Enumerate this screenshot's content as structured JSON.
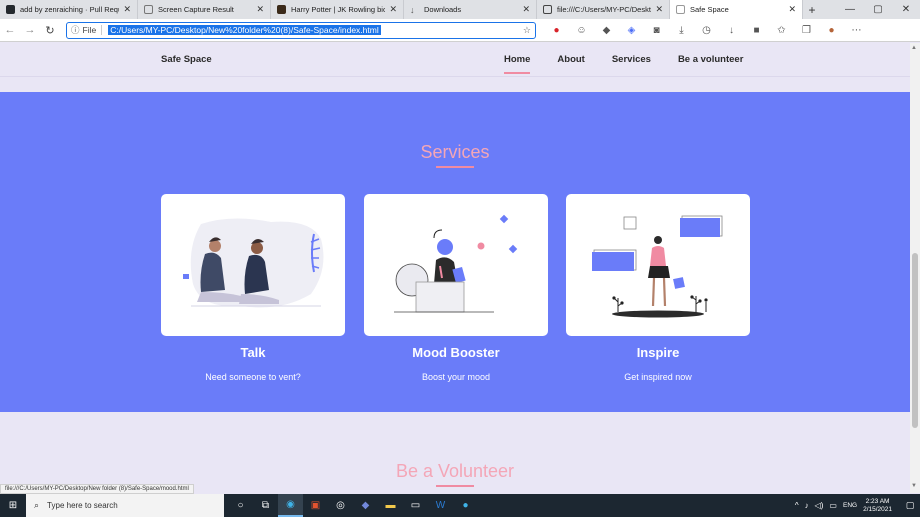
{
  "browser": {
    "tabs": [
      {
        "label": "add by zenraiching · Pull Reque",
        "icon_color": "#24292e",
        "active": false
      },
      {
        "label": "Screen Capture Result",
        "icon_color": "#777777",
        "active": false
      },
      {
        "label": "Harry Potter | JK Rowling biogr",
        "icon_color": "#3b2a1a",
        "active": false
      },
      {
        "label": "Downloads",
        "icon_color": "#555555",
        "active": false
      },
      {
        "label": "file:///C:/Users/MY-PC/Desktop",
        "icon_color": "#444444",
        "active": false
      },
      {
        "label": "Safe Space",
        "icon_color": "#999999",
        "active": true
      }
    ],
    "new_tab": "+",
    "win_controls": {
      "minimize": "—",
      "maximize": "▢",
      "close": "✕"
    },
    "address": {
      "info_icon": "ⓘ",
      "scheme": "File",
      "url": "C:/Users/MY-PC/Desktop/New%20folder%20(8)/Safe-Space/index.html"
    }
  },
  "site": {
    "brand": "Safe Space",
    "nav": [
      "Home",
      "About",
      "Services",
      "Be a volunteer"
    ],
    "services": {
      "title": "Services",
      "cards": [
        {
          "title": "Talk",
          "subtitle": "Need someone to vent?"
        },
        {
          "title": "Mood Booster",
          "subtitle": "Boost your mood"
        },
        {
          "title": "Inspire",
          "subtitle": "Get inspired now"
        }
      ]
    },
    "volunteer_title": "Be a Volunteer"
  },
  "status_url": "file:///C:/Users/MY-PC/Desktop/New folder (8)/Safe-Space/mood.html",
  "taskbar": {
    "search_placeholder": "Type here to search",
    "tray_lang": "ENG",
    "time": "2:23 AM",
    "date": "2/15/2021"
  },
  "colors": {
    "accent": "#6a7cf9",
    "pink": "#f08ba2",
    "background": "#e9e6f5"
  }
}
